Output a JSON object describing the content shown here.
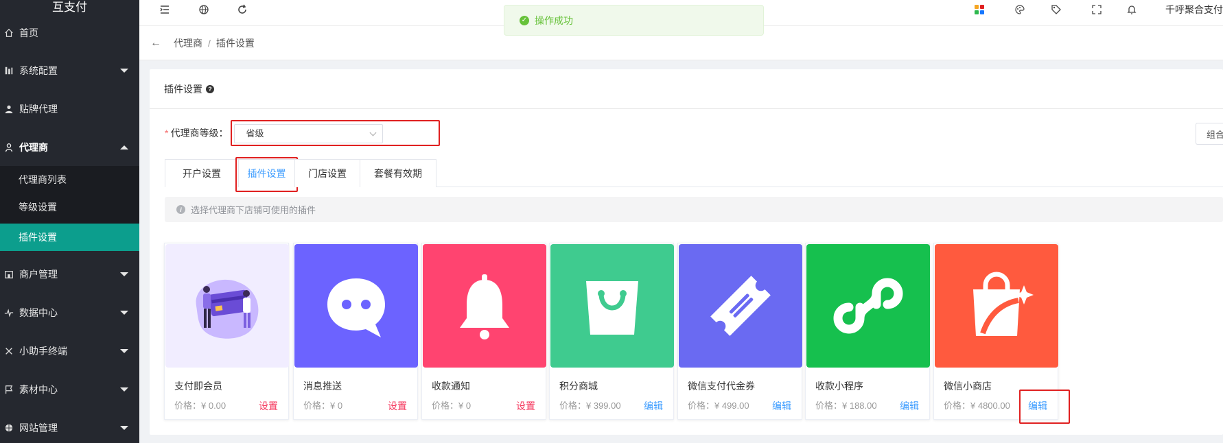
{
  "app": {
    "logo": "互支付"
  },
  "sidebar": {
    "items": [
      {
        "label": "首页",
        "icon": "home-icon"
      },
      {
        "label": "系统配置",
        "icon": "settings-icon"
      },
      {
        "label": "贴牌代理",
        "icon": "user-icon"
      },
      {
        "label": "代理商",
        "icon": "agent-icon"
      },
      {
        "label": "商户管理",
        "icon": "shop-icon"
      },
      {
        "label": "数据中心",
        "icon": "chart-icon"
      },
      {
        "label": "小助手终端",
        "icon": "terminal-icon"
      },
      {
        "label": "素材中心",
        "icon": "flag-icon"
      },
      {
        "label": "网站管理",
        "icon": "globe-icon"
      }
    ],
    "submenu": [
      {
        "label": "代理商列表"
      },
      {
        "label": "等级设置"
      },
      {
        "label": "插件设置"
      }
    ]
  },
  "header": {
    "toast": "操作成功",
    "username": "千呼聚合支付"
  },
  "breadcrumb": {
    "parent": "代理商",
    "separator": "/",
    "current": "插件设置"
  },
  "card": {
    "title": "插件设置",
    "level_label": "代理商等级：",
    "level_value": "省级",
    "right_button": "组合"
  },
  "tabs": [
    {
      "label": "开户设置"
    },
    {
      "label": "插件设置"
    },
    {
      "label": "门店设置"
    },
    {
      "label": "套餐有效期"
    }
  ],
  "tip": "选择代理商下店铺可使用的插件",
  "plugins": [
    {
      "name": "支付即会员",
      "price": "价格：¥ 0.00",
      "action": "设置",
      "color": "#efeaff"
    },
    {
      "name": "消息推送",
      "price": "价格：¥ 0",
      "action": "设置",
      "color": "#6c63ff"
    },
    {
      "name": "收款通知",
      "price": "价格：¥ 0",
      "action": "设置",
      "color": "#ff4470"
    },
    {
      "name": "积分商城",
      "price": "价格：¥ 399.00",
      "action": "编辑",
      "color": "#3fcb8f"
    },
    {
      "name": "微信支付代金券",
      "price": "价格：¥ 499.00",
      "action": "编辑",
      "color": "#6a6af2"
    },
    {
      "name": "收款小程序",
      "price": "价格：¥ 188.00",
      "action": "编辑",
      "color": "#16c04e"
    },
    {
      "name": "微信小商店",
      "price": "价格：¥ 4800.00",
      "action": "编辑",
      "color": "#ff5a3e"
    }
  ]
}
